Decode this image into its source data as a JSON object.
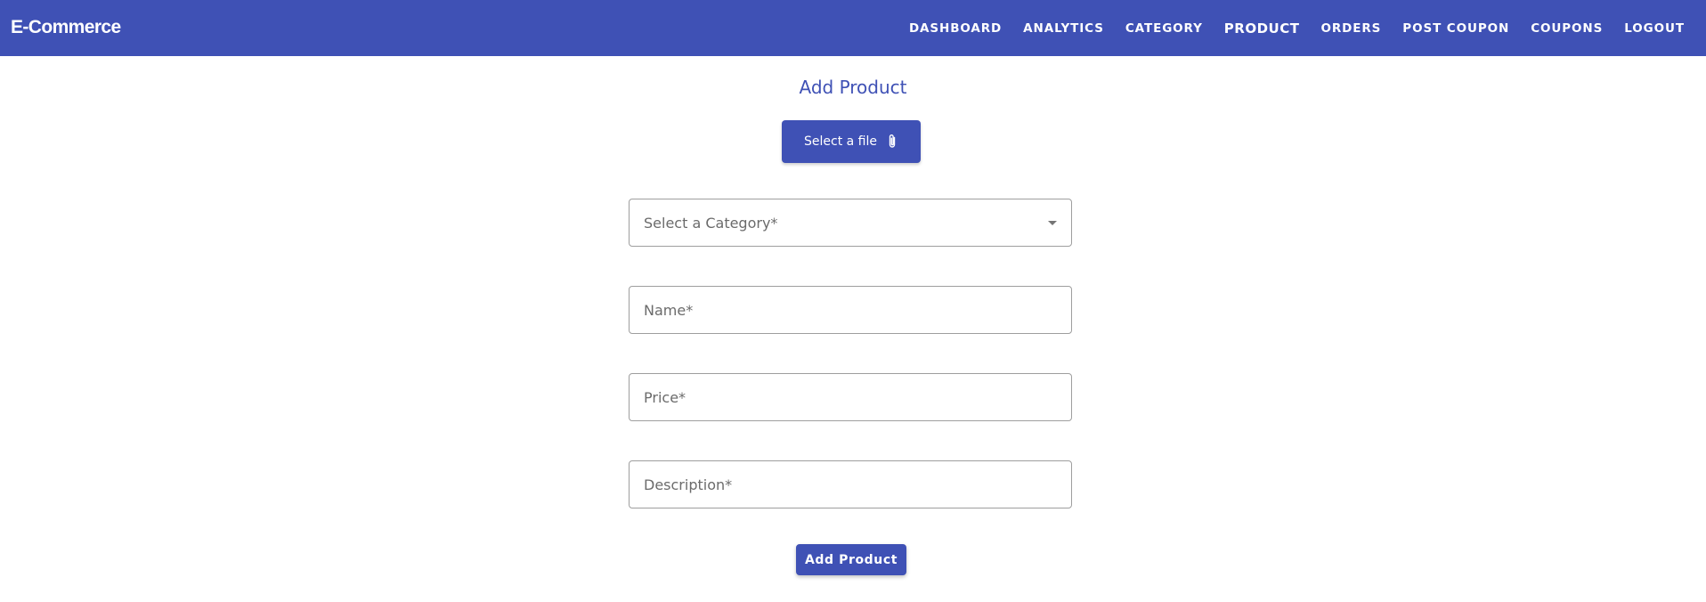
{
  "app": {
    "brand": "E-Commerce",
    "accent_color": "#3f51b5"
  },
  "nav": {
    "items": [
      {
        "label": "DASHBOARD"
      },
      {
        "label": "ANALYTICS"
      },
      {
        "label": "CATEGORY"
      },
      {
        "label": "PRODUCT",
        "active": true
      },
      {
        "label": "ORDERS"
      },
      {
        "label": "POST COUPON"
      },
      {
        "label": "COUPONS"
      },
      {
        "label": "LOGOUT"
      }
    ]
  },
  "form": {
    "title": "Add Product",
    "file_button_label": "Select a file",
    "file_button_icon": "paperclip-icon",
    "category_placeholder": "Select a Category*",
    "name_placeholder": "Name*",
    "price_placeholder": "Price*",
    "description_placeholder": "Description*",
    "submit_label": "Add Product"
  }
}
